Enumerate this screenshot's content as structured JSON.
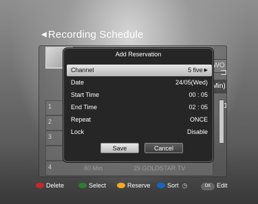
{
  "recording_schedule": {
    "title": "Recording Schedule",
    "back_icon": "left-arrow-icon",
    "rows": [
      {
        "index": "1"
      },
      {
        "index": "2"
      },
      {
        "index": "3"
      },
      {
        "index": "4"
      }
    ],
    "right_box_1": "WO",
    "right_box_2": "Min)",
    "background_row": {
      "duration": "80 Min",
      "channel": "29 GOLDSTAR TV"
    }
  },
  "dialog": {
    "title": "Add Reservation",
    "fields": [
      {
        "label": "Channel",
        "value": "5 five",
        "selected": true,
        "has_arrow": true
      },
      {
        "label": "Date",
        "value": "24/05(Wed)"
      },
      {
        "label": "Start Time",
        "value": "00 : 05"
      },
      {
        "label": "End Time",
        "value": "02 : 05"
      },
      {
        "label": "Repeat",
        "value": "ONCE"
      },
      {
        "label": "Lock",
        "value": "Disable"
      }
    ],
    "save_label": "Save",
    "cancel_label": "Cancel"
  },
  "help_bar": {
    "items": [
      {
        "key_color": "#c62828",
        "label": "Delete"
      },
      {
        "key_color": "#2e7d32",
        "label": "Select"
      },
      {
        "key_color": "#f9a825",
        "label": "Reserve"
      },
      {
        "key_color": "#1565c0",
        "label": "Sort"
      },
      {
        "key_label": "OK",
        "label": "Edit"
      }
    ]
  },
  "colors": {
    "dialog_bg": "#262626",
    "selected_row": "#d0d0d0",
    "overlay_gray": "#7a7a7a"
  }
}
